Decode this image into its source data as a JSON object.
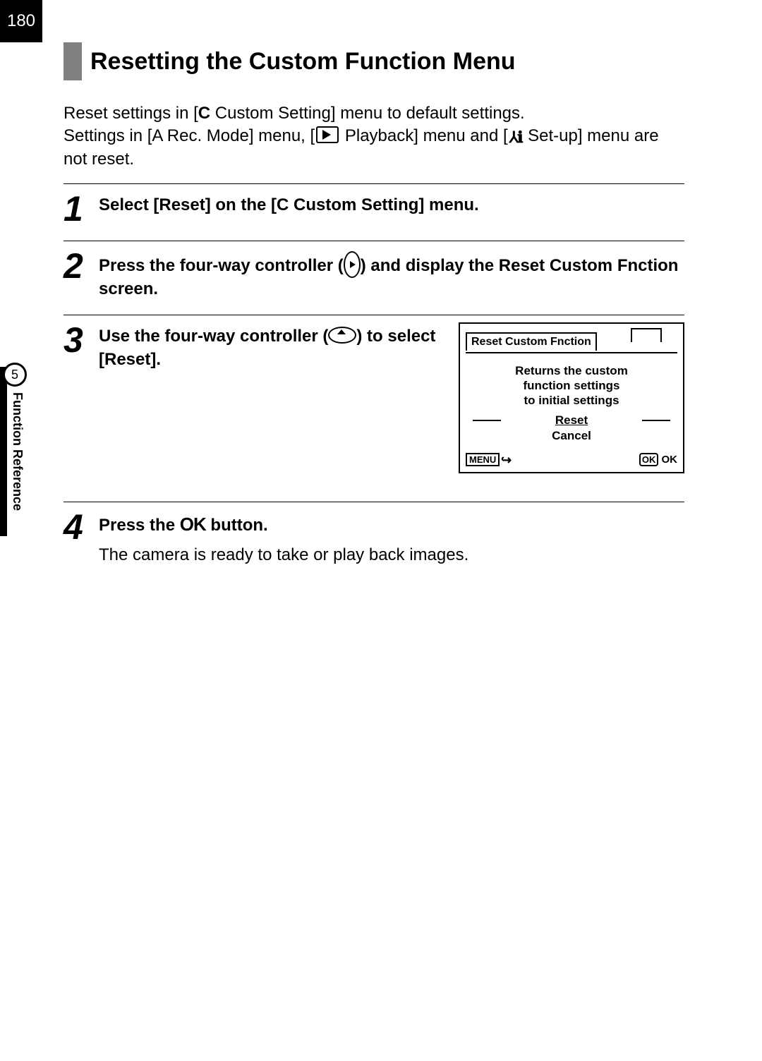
{
  "page_number": "180",
  "heading": "Resetting the Custom Function Menu",
  "intro_line1_a": "Reset settings in [",
  "intro_line1_b": "C",
  "intro_line1_c": " Custom Setting] menu to default settings.",
  "intro_line2_a": "Settings in [",
  "intro_line2_b": "A",
  "intro_line2_c": " Rec. Mode] menu, [",
  "intro_line2_d": " Playback] menu and [",
  "intro_line2_e": " Set-up] menu are not reset.",
  "setup_icon_text": "⅄ℹ",
  "steps": {
    "s1": {
      "num": "1",
      "text_a": "Select [Reset] on the [",
      "text_b": "C",
      "text_c": " Custom Setting] menu."
    },
    "s2": {
      "num": "2",
      "text_a": "Press the four-way controller (",
      "text_b": ") and display the Reset Custom Fnction screen."
    },
    "s3": {
      "num": "3",
      "text_a": "Use the four-way controller (",
      "text_b": ") to select [Reset]."
    },
    "s4": {
      "num": "4",
      "text_a": "Press the ",
      "text_b": "OK",
      "text_c": " button.",
      "sub": "The camera is ready to take or play back images."
    }
  },
  "lcd": {
    "title": "Reset Custom Fnction",
    "msg_l1": "Returns the custom",
    "msg_l2": "function settings",
    "msg_l3": "to initial settings",
    "reset": "Reset",
    "cancel": "Cancel",
    "menu": "MENU",
    "ok_box": "OK",
    "ok": "OK"
  },
  "sidebar": {
    "num": "5",
    "label": "Function Reference"
  }
}
